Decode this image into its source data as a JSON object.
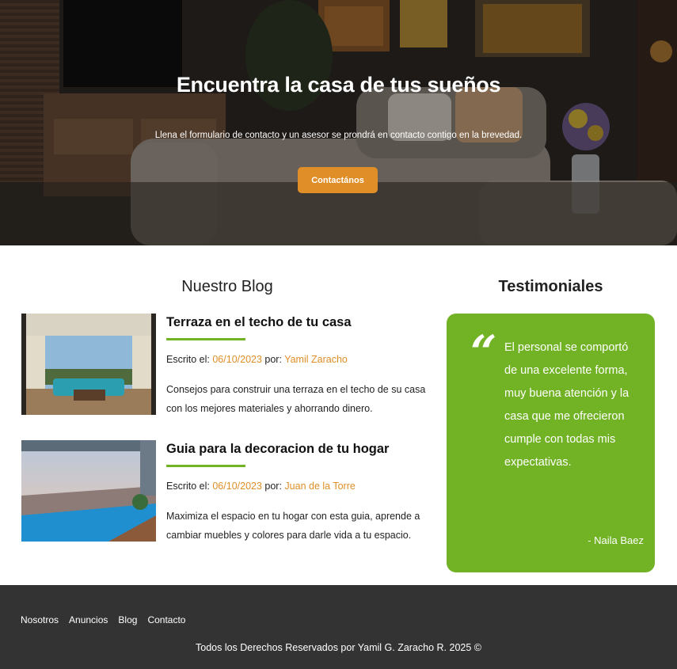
{
  "hero": {
    "title": "Encuentra la casa de tus sueños",
    "subtitle": "Llena el formulario de contacto y un asesor se prondrá en contacto contigo en la brevedad.",
    "cta_label": "Contactános"
  },
  "blog": {
    "heading": "Nuestro Blog",
    "posts": [
      {
        "title": "Terraza en el techo de tu casa",
        "meta_prefix": "Escrito el: ",
        "date": "06/10/2023",
        "meta_by": " por: ",
        "author": "Yamil Zaracho",
        "description": "Consejos para construir una terraza en el techo de su casa con los mejores materiales y ahorrando dinero."
      },
      {
        "title": "Guia para la decoracion de tu hogar",
        "meta_prefix": "Escrito el: ",
        "date": "06/10/2023",
        "meta_by": " por: ",
        "author": "Juan de la Torre",
        "description": "Maximiza el espacio en tu hogar con esta guia, aprende a cambiar muebles y colores para darle vida a tu espacio."
      }
    ]
  },
  "testimonials": {
    "heading": "Testimoniales",
    "quote_mark": "“",
    "text": "El personal se comportó de una excelente forma, muy buena atención y la casa que me ofrecieron cumple con todas mis expectativas.",
    "author": "- Naila Baez"
  },
  "footer": {
    "nav": [
      "Nosotros",
      "Anuncios",
      "Blog",
      "Contacto"
    ],
    "copyright": "Todos los Derechos Reservados por Yamil G. Zaracho R. 2025 ©"
  },
  "colors": {
    "accent_orange": "#e08e27",
    "accent_green": "#71b324",
    "footer_bg": "#333333"
  }
}
